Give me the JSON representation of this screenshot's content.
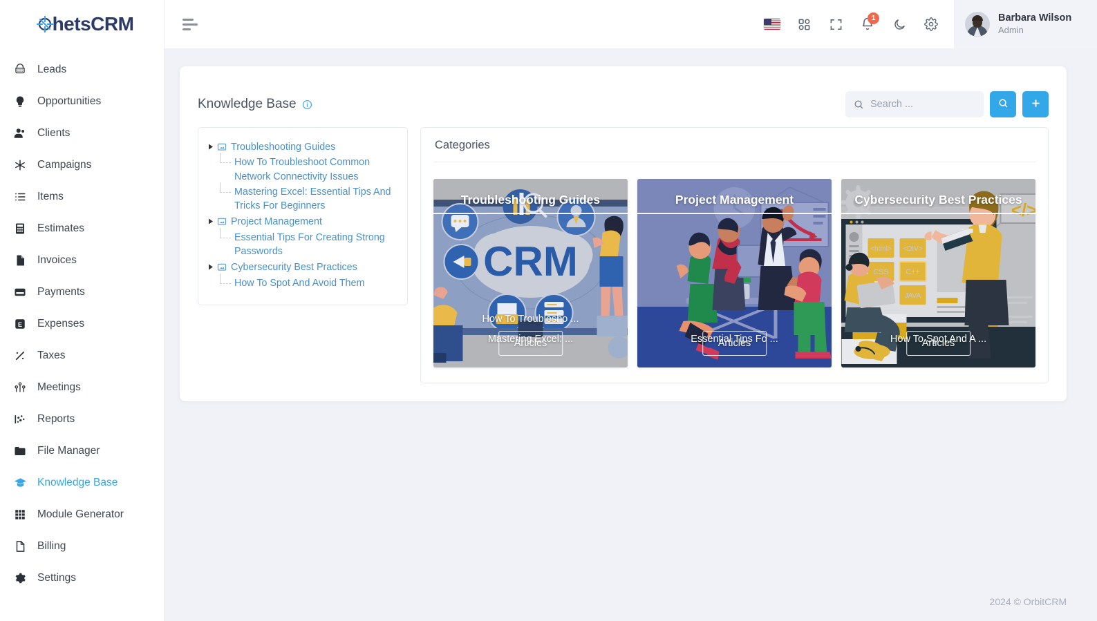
{
  "brand": {
    "name": "hetsCRM",
    "logo_icon": "crm-target-logo-icon",
    "accent": "#33a8e8",
    "text_color": "#2b3a67"
  },
  "sidebar": {
    "items": [
      {
        "label": "Leads",
        "icon": "leads-icon",
        "active": false
      },
      {
        "label": "Opportunities",
        "icon": "opportunities-icon",
        "active": false
      },
      {
        "label": "Clients",
        "icon": "clients-icon",
        "active": false
      },
      {
        "label": "Campaigns",
        "icon": "campaigns-icon",
        "active": false
      },
      {
        "label": "Items",
        "icon": "items-icon",
        "active": false
      },
      {
        "label": "Estimates",
        "icon": "estimates-icon",
        "active": false
      },
      {
        "label": "Invoices",
        "icon": "invoices-icon",
        "active": false
      },
      {
        "label": "Payments",
        "icon": "payments-icon",
        "active": false
      },
      {
        "label": "Expenses",
        "icon": "expenses-icon",
        "active": false
      },
      {
        "label": "Taxes",
        "icon": "taxes-icon",
        "active": false
      },
      {
        "label": "Meetings",
        "icon": "meetings-icon",
        "active": false
      },
      {
        "label": "Reports",
        "icon": "reports-icon",
        "active": false
      },
      {
        "label": "File Manager",
        "icon": "file-manager-icon",
        "active": false
      },
      {
        "label": "Knowledge Base",
        "icon": "knowledge-base-icon",
        "active": true
      },
      {
        "label": "Module Generator",
        "icon": "module-generator-icon",
        "active": false
      },
      {
        "label": "Billing",
        "icon": "billing-icon",
        "active": false
      },
      {
        "label": "Settings",
        "icon": "settings-icon",
        "active": false
      }
    ]
  },
  "topbar": {
    "menu_icon": "hamburger-menu-icon",
    "language_flag": "us-flag-icon",
    "apps_icon": "apps-grid-icon",
    "fullscreen_icon": "fullscreen-icon",
    "notifications_icon": "bell-icon",
    "notification_count": "1",
    "dark_mode_icon": "moon-icon",
    "settings_icon": "gear-icon",
    "user": {
      "name": "Barbara Wilson",
      "role": "Admin",
      "avatar": "user-avatar"
    }
  },
  "page": {
    "title": "Knowledge Base",
    "info_icon": "info-circle-icon",
    "search": {
      "placeholder": "Search ...",
      "value": "",
      "icon": "search-icon"
    },
    "search_button_icon": "search-icon",
    "add_button_icon": "plus-icon"
  },
  "tree": {
    "nodes": [
      {
        "label": "Troubleshooting Guides",
        "icon": "category-screen-icon",
        "caret": "caret-right-icon",
        "children": [
          "How To Troubleshoot Common Network Connectivity Issues",
          "Mastering Excel: Essential Tips And Tricks For Beginners"
        ]
      },
      {
        "label": "Project Management",
        "icon": "category-screen-icon",
        "caret": "caret-right-icon",
        "children": [
          "Essential Tips For Creating Strong Passwords"
        ]
      },
      {
        "label": "Cybersecurity Best Practices",
        "icon": "category-screen-icon",
        "caret": "caret-right-icon",
        "children": [
          "How To Spot And Avoid Them"
        ]
      }
    ]
  },
  "categories": {
    "heading": "Categories",
    "cards": [
      {
        "title": "Troubleshooting Guides",
        "articles": [
          "How To Troublesho ...",
          "Mastering Excel: ..."
        ],
        "button": "Articles",
        "theme": "crm-cloud-illustration"
      },
      {
        "title": "Project Management",
        "articles": [
          "Essential Tips Fo ..."
        ],
        "button": "Articles",
        "theme": "team-meeting-illustration"
      },
      {
        "title": "Cybersecurity Best Practices",
        "articles": [
          "How To Spot And A ..."
        ],
        "button": "Articles",
        "theme": "coding-classroom-illustration"
      }
    ]
  },
  "footer": {
    "copyright": "2024 © OrbitCRM"
  }
}
